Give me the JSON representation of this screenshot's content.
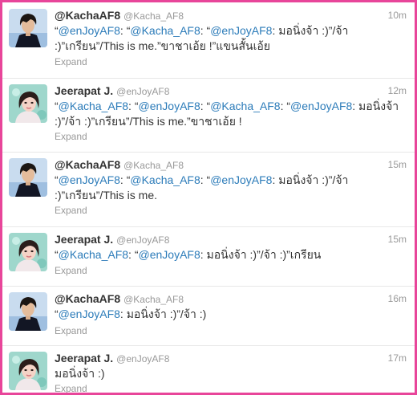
{
  "colors": {
    "border": "#e8459a",
    "link": "#2b7bb9",
    "meta": "#999999",
    "text": "#333333"
  },
  "tweets": [
    {
      "fullname": "@KachaAF8",
      "screenname": "@Kacha_AF8",
      "time": "10m",
      "avatar": "kacha-avatar",
      "text": [
        {
          "t": "“",
          "m": false
        },
        {
          "t": "@enJoyAF8",
          "m": true
        },
        {
          "t": ": “",
          "m": false
        },
        {
          "t": "@Kacha_AF8",
          "m": true
        },
        {
          "t": ": “",
          "m": false
        },
        {
          "t": "@enJoyAF8",
          "m": true
        },
        {
          "t": ": มอนิ่งจ้า :)”/จ้า :)”เกรียน”/This is me.”ขาชาเอ้ย !”แขนสั้นเอ้ย",
          "m": false
        }
      ],
      "expand": "Expand"
    },
    {
      "fullname": "Jeerapat J.",
      "screenname": "@enJoyAF8",
      "time": "12m",
      "avatar": "jeerapat-avatar",
      "text": [
        {
          "t": "“",
          "m": false
        },
        {
          "t": "@Kacha_AF8",
          "m": true
        },
        {
          "t": ": “",
          "m": false
        },
        {
          "t": "@enJoyAF8",
          "m": true
        },
        {
          "t": ": “",
          "m": false
        },
        {
          "t": "@Kacha_AF8",
          "m": true
        },
        {
          "t": ": “",
          "m": false
        },
        {
          "t": "@enJoyAF8",
          "m": true
        },
        {
          "t": ": มอนิ่งจ้า :)”/จ้า :)”เกรียน”/This is me.”ขาชาเอ้ย !",
          "m": false
        }
      ],
      "expand": "Expand"
    },
    {
      "fullname": "@KachaAF8",
      "screenname": "@Kacha_AF8",
      "time": "15m",
      "avatar": "kacha-avatar",
      "text": [
        {
          "t": "“",
          "m": false
        },
        {
          "t": "@enJoyAF8",
          "m": true
        },
        {
          "t": ": “",
          "m": false
        },
        {
          "t": "@Kacha_AF8",
          "m": true
        },
        {
          "t": ": “",
          "m": false
        },
        {
          "t": "@enJoyAF8",
          "m": true
        },
        {
          "t": ": มอนิ่งจ้า :)”/จ้า :)”เกรียน”/This is me.",
          "m": false
        }
      ],
      "expand": "Expand"
    },
    {
      "fullname": "Jeerapat J.",
      "screenname": "@enJoyAF8",
      "time": "15m",
      "avatar": "jeerapat-avatar",
      "text": [
        {
          "t": "“",
          "m": false
        },
        {
          "t": "@Kacha_AF8",
          "m": true
        },
        {
          "t": ": “",
          "m": false
        },
        {
          "t": "@enJoyAF8",
          "m": true
        },
        {
          "t": ": มอนิ่งจ้า :)”/จ้า :)”เกรียน",
          "m": false
        }
      ],
      "expand": "Expand"
    },
    {
      "fullname": "@KachaAF8",
      "screenname": "@Kacha_AF8",
      "time": "16m",
      "avatar": "kacha-avatar",
      "text": [
        {
          "t": "“",
          "m": false
        },
        {
          "t": "@enJoyAF8",
          "m": true
        },
        {
          "t": ": มอนิ่งจ้า :)”/จ้า :)",
          "m": false
        }
      ],
      "expand": "Expand"
    },
    {
      "fullname": "Jeerapat J.",
      "screenname": "@enJoyAF8",
      "time": "17m",
      "avatar": "jeerapat-avatar",
      "text": [
        {
          "t": "มอนิ่งจ้า :)",
          "m": false
        }
      ],
      "expand": "Expand"
    }
  ]
}
